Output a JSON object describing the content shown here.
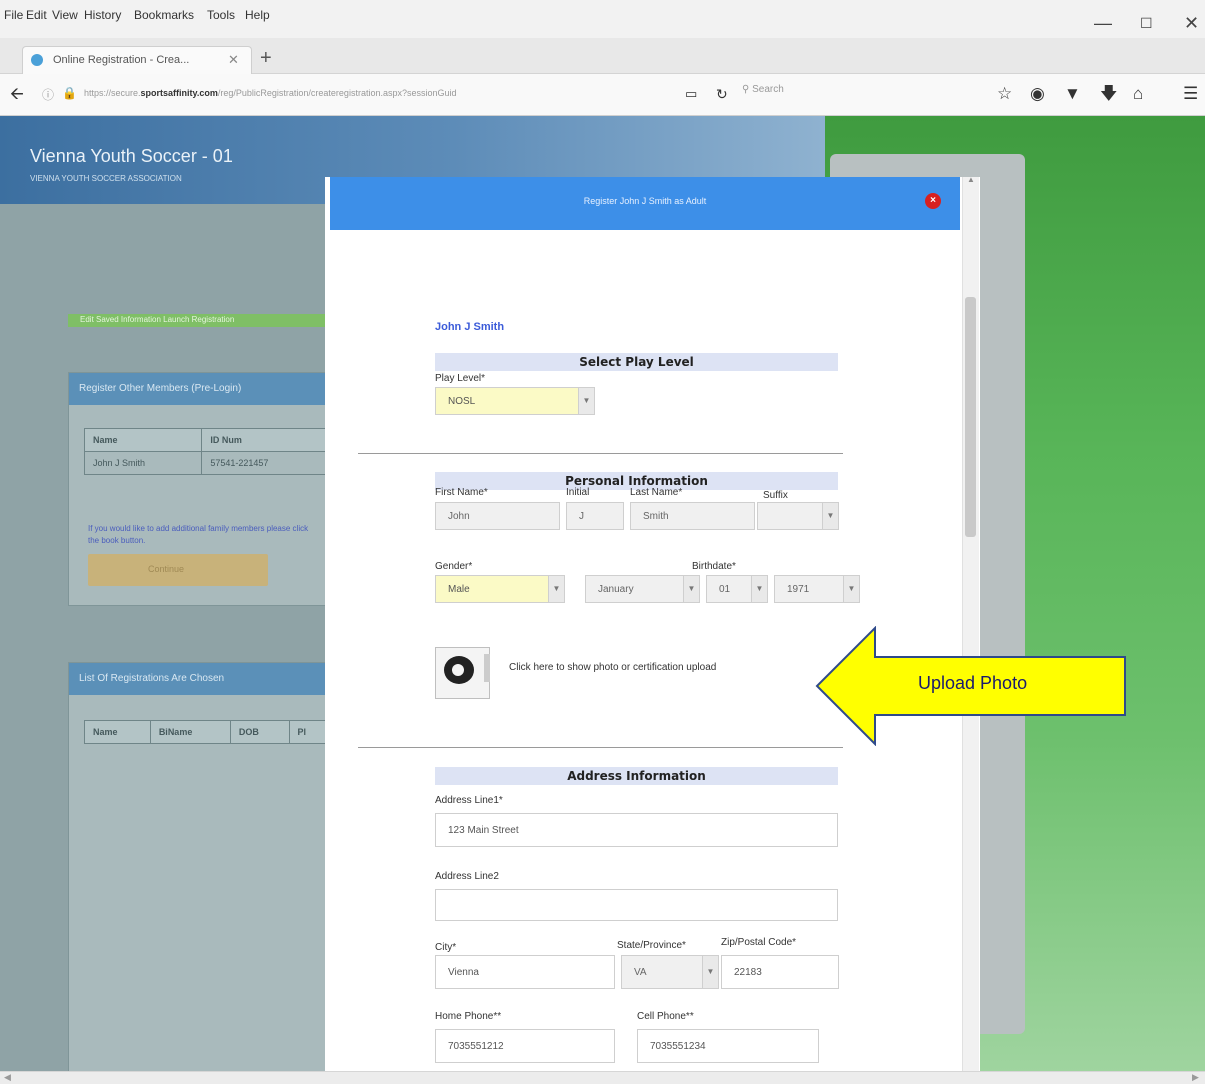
{
  "browser": {
    "menu": [
      "File",
      "Edit",
      "View",
      "History",
      "Bookmarks",
      "Tools",
      "Help"
    ],
    "tab_title": "Online Registration - Crea...",
    "url_prefix": "https://secure.",
    "url_domain": "sportsaffinity.com",
    "url_path": "/reg/PublicRegistration/createregistration.aspx?sessionGuid",
    "search_placeholder": "Search",
    "icons": [
      "back-icon",
      "refresh-icon",
      "star-icon",
      "library-icon",
      "pocket-icon",
      "download-icon",
      "home-icon",
      "menu-icon"
    ]
  },
  "background": {
    "site_title": "Vienna Youth Soccer - 01",
    "site_subtitle": "VIENNA YOUTH SOCCER ASSOCIATION",
    "green_bar": "Edit Saved Information    Launch Registration",
    "box1_title": "Register Other Members (Pre-Login)",
    "box1_headers": [
      "Name",
      "ID Num"
    ],
    "box1_row": [
      "John J Smith",
      "57541-221457"
    ],
    "box1_link": "If you would like to add additional family members please click the book button.",
    "box1_button": "Continue",
    "box2_title": "List Of Registrations Are Chosen",
    "box2_headers": [
      "Name",
      "BiName",
      "DOB",
      "Pl"
    ]
  },
  "modal": {
    "title": "Register John J Smith as Adult",
    "person_name": "John J Smith",
    "play_section": "Select Play Level",
    "play_level_label": "Play Level*",
    "play_level_value": "NOSL",
    "personal_section": "Personal Information",
    "first_name_label": "First Name*",
    "initial_label": "Initial",
    "last_name_label": "Last Name*",
    "suffix_label": "Suffix",
    "first_name": "John",
    "initial": "J",
    "last_name": "Smith",
    "gender_label": "Gender*",
    "birthdate_label": "Birthdate*",
    "gender": "Male",
    "birth_month": "January",
    "birth_day": "01",
    "birth_year": "1971",
    "upload_text": "Click here to show photo or certification upload",
    "address_section": "Address Information",
    "address1_label": "Address Line1*",
    "address1": "123 Main Street",
    "address2_label": "Address Line2",
    "address2": "",
    "city_label": "City*",
    "state_label": "State/Province*",
    "zip_label": "Zip/Postal Code*",
    "city": "Vienna",
    "state": "VA",
    "zip": "22183",
    "home_phone_label": "Home Phone**",
    "cell_phone_label": "Cell Phone**",
    "home_phone": "7035551212",
    "cell_phone": "7035551234"
  },
  "annotation": {
    "text": "Upload Photo",
    "fill": "#ffff00",
    "stroke": "#2f4a8a"
  }
}
